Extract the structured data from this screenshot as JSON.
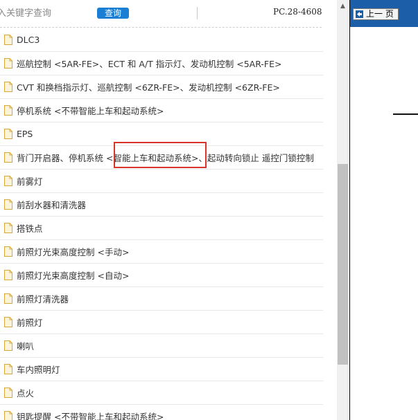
{
  "search": {
    "placeholder": "入关键字查询",
    "button_label": "查询",
    "doc_code": "PC.28-4608"
  },
  "items": [
    {
      "label": "DLC3"
    },
    {
      "label": "巡航控制 <5AR-FE>、ECT 和 A/T 指示灯、发动机控制 <5AR-FE>"
    },
    {
      "label": "CVT 和换档指示灯、巡航控制 <6ZR-FE>、发动机控制 <6ZR-FE>"
    },
    {
      "label": "停机系统 <不带智能上车和起动系统>"
    },
    {
      "label": "EPS"
    },
    {
      "label": "背门开启器、停机系统 <智能上车和起动系统>、起动转向锁止 遥控门锁控制"
    },
    {
      "label": "前雾灯"
    },
    {
      "label": "前刮水器和清洗器"
    },
    {
      "label": "搭铁点"
    },
    {
      "label": "前照灯光束高度控制 <手动>"
    },
    {
      "label": "前照灯光束高度控制 <自动>"
    },
    {
      "label": "前照灯清洗器"
    },
    {
      "label": "前照灯"
    },
    {
      "label": "喇叭"
    },
    {
      "label": "车内照明灯"
    },
    {
      "label": "点火"
    },
    {
      "label": "钥匙提醒 <不带智能上车和起动系统>"
    }
  ],
  "right_pane": {
    "prev_page_label": "上一 页"
  },
  "colors": {
    "button_blue": "#1a7fd4",
    "strip_blue": "#1c5fa8",
    "highlight_red": "#d9342b",
    "doc_icon_fill": "#fdf3d8",
    "doc_icon_stroke": "#d9a73a"
  }
}
